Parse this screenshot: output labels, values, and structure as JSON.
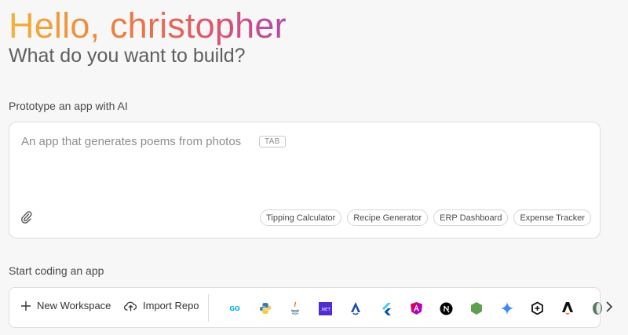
{
  "greeting": "Hello, christopher",
  "subtitle": "What do you want to build?",
  "prototype": {
    "label": "Prototype an app with AI",
    "placeholder": "An app that generates poems from photos",
    "tab_hint": "TAB",
    "suggestions": [
      "Tipping Calculator",
      "Recipe Generator",
      "ERP Dashboard",
      "Expense Tracker"
    ]
  },
  "coding": {
    "label": "Start coding an app",
    "new_workspace": "New Workspace",
    "import_repo": "Import Repo",
    "frameworks": [
      {
        "name": "Go",
        "icon": "go-icon"
      },
      {
        "name": "Python",
        "icon": "python-icon"
      },
      {
        "name": "Java",
        "icon": "java-icon"
      },
      {
        "name": ".NET",
        "icon": "dotnet-icon",
        "text": ".NET"
      },
      {
        "name": "Astro",
        "icon": "astro-icon"
      },
      {
        "name": "Flutter",
        "icon": "flutter-icon"
      },
      {
        "name": "Angular",
        "icon": "angular-icon"
      },
      {
        "name": "Next.js",
        "icon": "nextjs-icon",
        "text": "N"
      },
      {
        "name": "Node.js",
        "icon": "nodejs-icon"
      },
      {
        "name": "Gemini",
        "icon": "gemini-icon"
      },
      {
        "name": "Hexagon",
        "icon": "hexagon-icon"
      },
      {
        "name": "Astro",
        "icon": "astro-a-icon"
      },
      {
        "name": "Other",
        "icon": "leaf-icon"
      }
    ]
  },
  "colors": {
    "accent_start": "#f4b23c",
    "accent_end": "#b14aa8",
    "dotnet": "#512bd4",
    "node": "#5fa04e",
    "gemini": "#4285f4"
  }
}
